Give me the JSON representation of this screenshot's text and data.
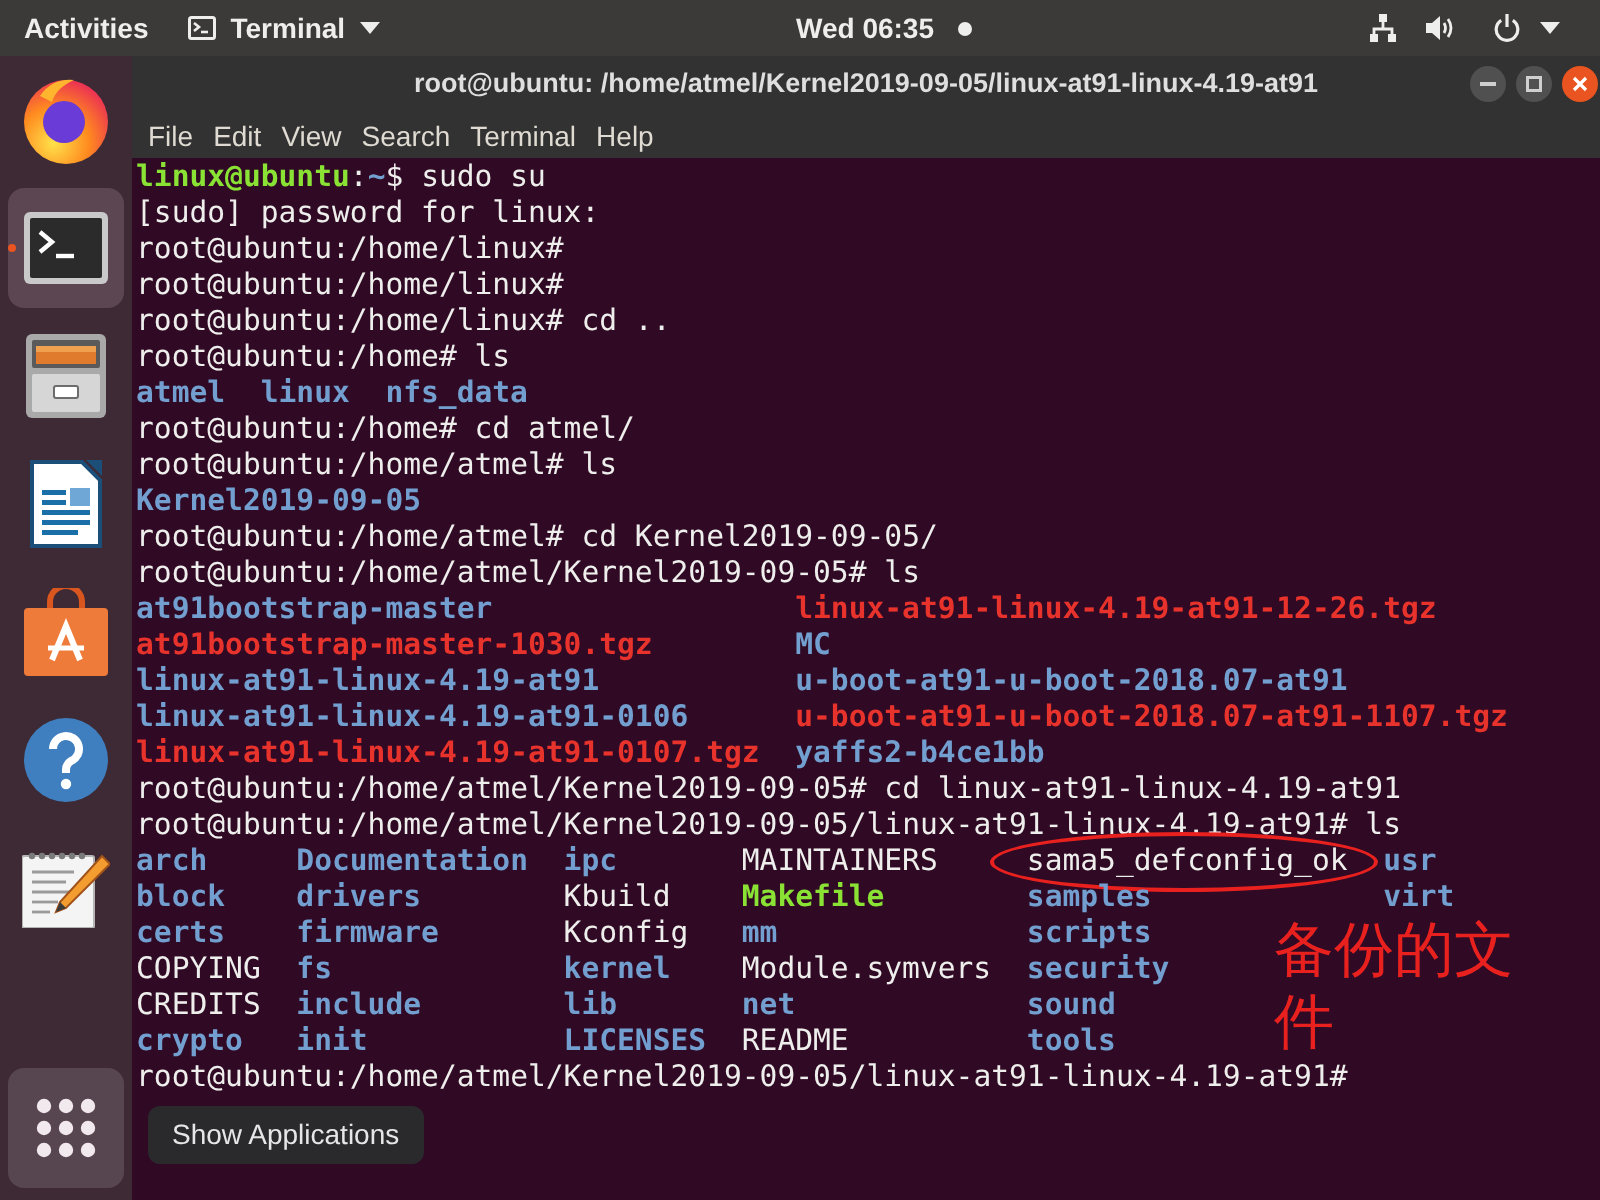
{
  "top_bar": {
    "activities": "Activities",
    "app_menu": "Terminal",
    "clock": "Wed 06:35"
  },
  "dock": {
    "items": [
      {
        "kind": "browser",
        "active": false,
        "running": false
      },
      {
        "kind": "terminal",
        "active": true,
        "running": true
      },
      {
        "kind": "files",
        "active": false,
        "running": false
      },
      {
        "kind": "writer",
        "active": false,
        "running": false
      },
      {
        "kind": "software",
        "active": false,
        "running": false
      },
      {
        "kind": "help",
        "active": false,
        "running": false
      },
      {
        "kind": "text_editor",
        "active": false,
        "running": false
      }
    ],
    "show_applications": {
      "hovered": true,
      "tooltip": "Show Applications"
    }
  },
  "window": {
    "title": "root@ubuntu: /home/atmel/Kernel2019-09-05/linux-at91-linux-4.19-at91",
    "menu": [
      "File",
      "Edit",
      "View",
      "Search",
      "Terminal",
      "Help"
    ]
  },
  "terminal": {
    "lines": [
      {
        "kind": "segments",
        "segments": [
          {
            "text": "linux@ubuntu",
            "kind": "user"
          },
          {
            "text": ":",
            "kind": "plain"
          },
          {
            "text": "~",
            "kind": "path"
          },
          {
            "text": "$ sudo su",
            "kind": "plain"
          }
        ]
      },
      {
        "kind": "text",
        "text": "[sudo] password for linux:"
      },
      {
        "kind": "text",
        "text": "root@ubuntu:/home/linux#"
      },
      {
        "kind": "text",
        "text": "root@ubuntu:/home/linux#"
      },
      {
        "kind": "text",
        "text": "root@ubuntu:/home/linux# cd .."
      },
      {
        "kind": "text",
        "text": "root@ubuntu:/home# ls"
      },
      {
        "kind": "listing",
        "rows": [
          [
            {
              "name": "atmel",
              "kind": "directory",
              "circled": false
            },
            {
              "name": "linux",
              "kind": "directory",
              "circled": false
            },
            {
              "name": "nfs_data",
              "kind": "directory",
              "circled": false
            }
          ]
        ]
      },
      {
        "kind": "text",
        "text": "root@ubuntu:/home# cd atmel/"
      },
      {
        "kind": "text",
        "text": "root@ubuntu:/home/atmel# ls"
      },
      {
        "kind": "listing",
        "rows": [
          [
            {
              "name": "Kernel2019-09-05",
              "kind": "directory",
              "circled": false
            }
          ]
        ]
      },
      {
        "kind": "text",
        "text": "root@ubuntu:/home/atmel# cd Kernel2019-09-05/"
      },
      {
        "kind": "text",
        "text": "root@ubuntu:/home/atmel/Kernel2019-09-05# ls"
      },
      {
        "kind": "listing",
        "rows": [
          [
            {
              "name": "at91bootstrap-master",
              "kind": "directory",
              "circled": false
            },
            {
              "name": "linux-at91-linux-4.19-at91-12-26.tgz",
              "kind": "archive",
              "circled": false
            }
          ],
          [
            {
              "name": "at91bootstrap-master-1030.tgz",
              "kind": "archive",
              "circled": false
            },
            {
              "name": "MC",
              "kind": "directory",
              "circled": false
            }
          ],
          [
            {
              "name": "linux-at91-linux-4.19-at91",
              "kind": "directory",
              "circled": false
            },
            {
              "name": "u-boot-at91-u-boot-2018.07-at91",
              "kind": "directory",
              "circled": false
            }
          ],
          [
            {
              "name": "linux-at91-linux-4.19-at91-0106",
              "kind": "directory",
              "circled": false
            },
            {
              "name": "u-boot-at91-u-boot-2018.07-at91-1107.tgz",
              "kind": "archive",
              "circled": false
            }
          ],
          [
            {
              "name": "linux-at91-linux-4.19-at91-0107.tgz",
              "kind": "archive",
              "circled": false
            },
            {
              "name": "yaffs2-b4ce1bb",
              "kind": "directory",
              "circled": false
            }
          ]
        ]
      },
      {
        "kind": "text",
        "text": "root@ubuntu:/home/atmel/Kernel2019-09-05# cd linux-at91-linux-4.19-at91"
      },
      {
        "kind": "text",
        "text": "root@ubuntu:/home/atmel/Kernel2019-09-05/linux-at91-linux-4.19-at91# ls"
      },
      {
        "kind": "listing",
        "rows": [
          [
            {
              "name": "arch",
              "kind": "directory",
              "circled": false
            },
            {
              "name": "Documentation",
              "kind": "directory",
              "circled": false
            },
            {
              "name": "ipc",
              "kind": "directory",
              "circled": false
            },
            {
              "name": "MAINTAINERS",
              "kind": "file",
              "circled": false
            },
            {
              "name": "sama5_defconfig_ok",
              "kind": "file",
              "circled": true
            },
            {
              "name": "usr",
              "kind": "directory",
              "circled": false
            }
          ],
          [
            {
              "name": "block",
              "kind": "directory",
              "circled": false
            },
            {
              "name": "drivers",
              "kind": "directory",
              "circled": false
            },
            {
              "name": "Kbuild",
              "kind": "file",
              "circled": false
            },
            {
              "name": "Makefile",
              "kind": "executable",
              "circled": false
            },
            {
              "name": "samples",
              "kind": "directory",
              "circled": false
            },
            {
              "name": "virt",
              "kind": "directory",
              "circled": false
            }
          ],
          [
            {
              "name": "certs",
              "kind": "directory",
              "circled": false
            },
            {
              "name": "firmware",
              "kind": "directory",
              "circled": false
            },
            {
              "name": "Kconfig",
              "kind": "file",
              "circled": false
            },
            {
              "name": "mm",
              "kind": "directory",
              "circled": false
            },
            {
              "name": "scripts",
              "kind": "directory",
              "circled": false
            }
          ],
          [
            {
              "name": "COPYING",
              "kind": "file",
              "circled": false
            },
            {
              "name": "fs",
              "kind": "directory",
              "circled": false
            },
            {
              "name": "kernel",
              "kind": "directory",
              "circled": false
            },
            {
              "name": "Module.symvers",
              "kind": "file",
              "circled": false
            },
            {
              "name": "security",
              "kind": "directory",
              "circled": false
            }
          ],
          [
            {
              "name": "CREDITS",
              "kind": "file",
              "circled": false
            },
            {
              "name": "include",
              "kind": "directory",
              "circled": false
            },
            {
              "name": "lib",
              "kind": "directory",
              "circled": false
            },
            {
              "name": "net",
              "kind": "directory",
              "circled": false
            },
            {
              "name": "sound",
              "kind": "directory",
              "circled": false
            }
          ],
          [
            {
              "name": "crypto",
              "kind": "directory",
              "circled": false
            },
            {
              "name": "init",
              "kind": "directory",
              "circled": false
            },
            {
              "name": "LICENSES",
              "kind": "directory",
              "circled": false
            },
            {
              "name": "README",
              "kind": "file",
              "circled": false
            },
            {
              "name": "tools",
              "kind": "directory",
              "circled": false
            }
          ]
        ]
      },
      {
        "kind": "text",
        "text": "root@ubuntu:/home/atmel/Kernel2019-09-05/linux-at91-linux-4.19-at91#"
      }
    ]
  },
  "annotation": {
    "text": "备份的文件"
  }
}
